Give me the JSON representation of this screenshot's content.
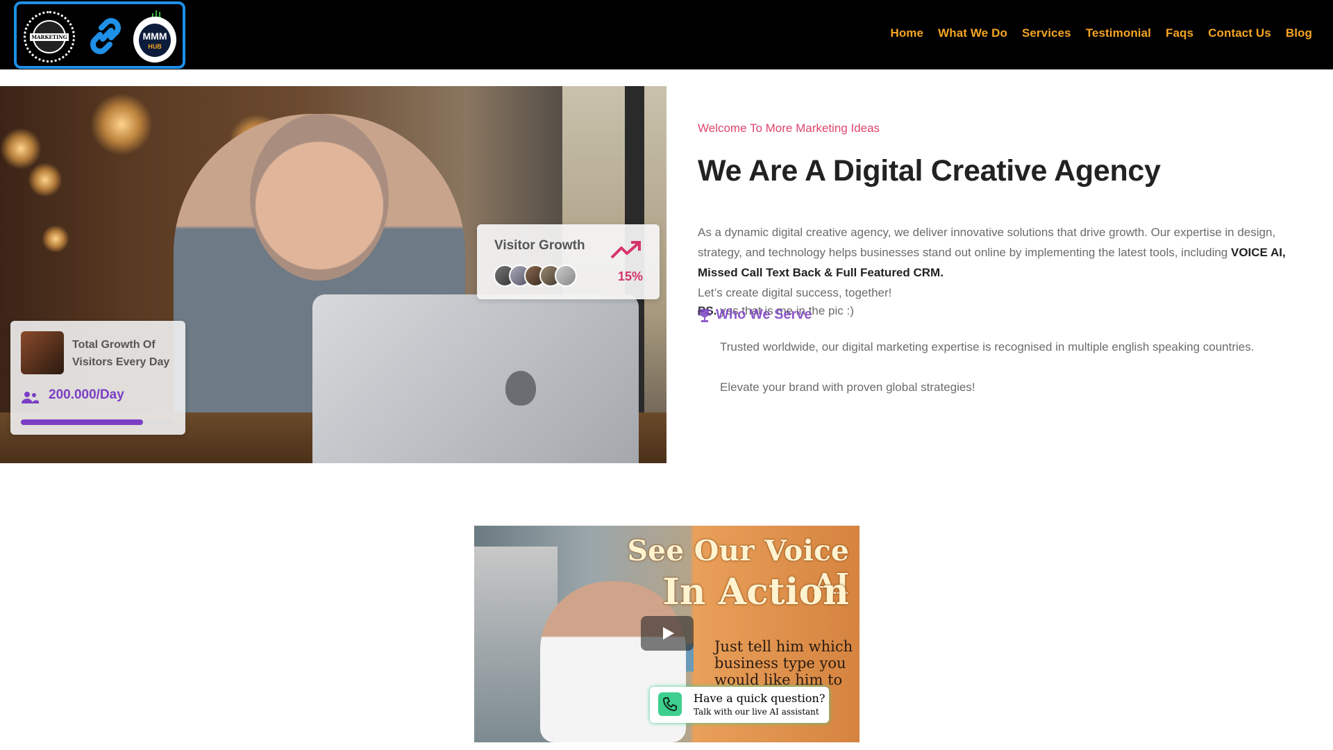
{
  "header": {
    "logo_text": "MARKETING",
    "logo_mmm": "MMM",
    "logo_hub": "HUB",
    "nav": [
      "Home",
      "What We Do",
      "Services",
      "Testimonial",
      "Faqs",
      "Contact Us",
      "Blog"
    ],
    "nav_color": "#f5a524",
    "logo_border_color": "#1e90e8"
  },
  "hero": {
    "visitor_card": {
      "title": "Visitor Growth",
      "percent": "15%",
      "icon": "trending-up-icon"
    },
    "growth_card": {
      "text": "Total Growth Of Visitors Every Day",
      "value": "200.000/Day",
      "icon": "users-icon",
      "progress_fraction": 0.8
    }
  },
  "intro": {
    "welcome": "Welcome To More Marketing Ideas",
    "headline": "We Are A Digital Creative Agency",
    "description_plain": "As a dynamic digital creative agency, we deliver innovative solutions that drive growth. Our expertise in design, strategy, and technology helps businesses stand out online by implementing the latest tools, including ",
    "description_bold": "VOICE AI, Missed Call Text Back & Full Featured CRM.",
    "closing": "Let’s create digital success, together!",
    "ps_label": "PS.",
    "ps_text": " yes that is me in the pic :)",
    "serve_heading": "Who We Serve",
    "trusted": "Trusted worldwide, our digital marketing expertise is recognised in multiple english speaking countries.",
    "elevate": "Elevate your brand with proven global strategies!"
  },
  "video": {
    "title_line1": "See Our Voice AI",
    "title_line2": "In Action",
    "subtitle": "Just tell him which business type you would like him to",
    "cta_title": "Have a quick question?",
    "cta_subtitle": "Talk with our live AI assistant",
    "accent": "#3ecf8e"
  }
}
